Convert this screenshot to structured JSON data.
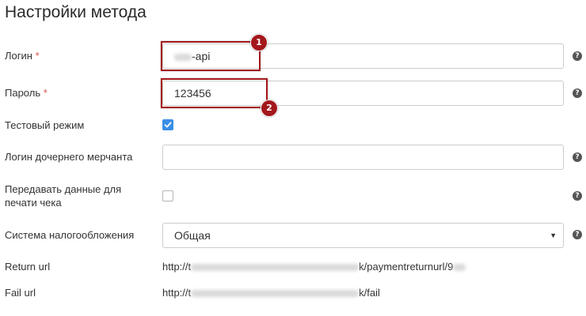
{
  "header": {
    "title": "Настройки метода"
  },
  "form": {
    "login": {
      "label": "Логин",
      "required_mark": "*",
      "value": "-api"
    },
    "password": {
      "label": "Пароль",
      "required_mark": "*",
      "value": "123456"
    },
    "test_mode": {
      "label": "Тестовый режим",
      "checked": true
    },
    "child_merchant_login": {
      "label": "Логин дочернего мерчанта",
      "value": ""
    },
    "receipt_data": {
      "label_line1": "Передавать данные для",
      "label_line2": "печати чека",
      "checked": false
    },
    "tax_system": {
      "label": "Система налогообложения",
      "selected": "Общая"
    },
    "return_url": {
      "label": "Return url",
      "prefix": "http://t",
      "suffix": "k/paymentreturnurl/9"
    },
    "fail_url": {
      "label": "Fail url",
      "prefix": "http://t",
      "suffix": "k/fail"
    }
  },
  "help_icon": {
    "glyph": "?"
  },
  "annotations": [
    {
      "number": "1"
    },
    {
      "number": "2"
    }
  ],
  "colors": {
    "accent": "#3a8ee6",
    "required": "#d9534f",
    "annotation": "#a3181c"
  }
}
